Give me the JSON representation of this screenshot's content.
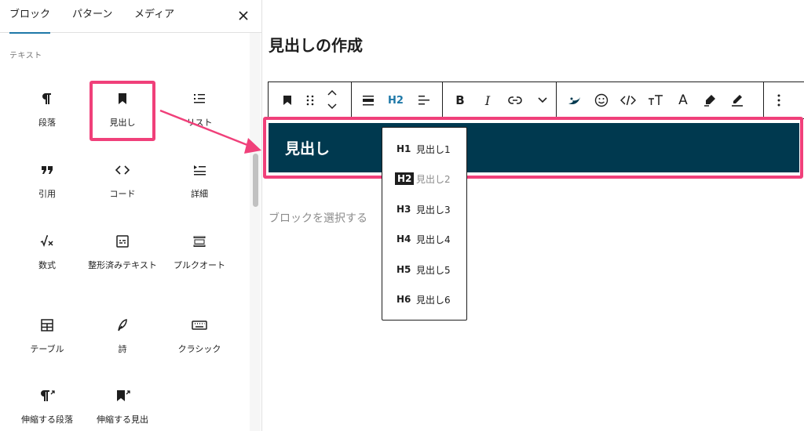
{
  "panel": {
    "tabs": [
      {
        "label": "ブロック",
        "active": true
      },
      {
        "label": "パターン",
        "active": false
      },
      {
        "label": "メディア",
        "active": false
      }
    ],
    "close_icon": "close-icon",
    "category_label": "テキスト",
    "blocks": [
      {
        "label": "段落",
        "icon": "pilcrow-icon"
      },
      {
        "label": "見出し",
        "icon": "bookmark-icon"
      },
      {
        "label": "リスト",
        "icon": "list-icon"
      },
      {
        "label": "引用",
        "icon": "quote-icon"
      },
      {
        "label": "コード",
        "icon": "code-icon"
      },
      {
        "label": "詳細",
        "icon": "details-icon"
      },
      {
        "label": "数式",
        "icon": "math-icon"
      },
      {
        "label": "整形済みテキスト",
        "icon": "preformatted-icon"
      },
      {
        "label": "プルクオート",
        "icon": "pullquote-icon"
      },
      {
        "label": "テーブル",
        "icon": "table-icon"
      },
      {
        "label": "詩",
        "icon": "feather-icon"
      },
      {
        "label": "クラシック",
        "icon": "keyboard-icon"
      },
      {
        "label": "伸縮する段落",
        "icon": "fit-pilcrow-icon"
      },
      {
        "label": "伸縮する見出",
        "icon": "fit-bookmark-icon"
      }
    ]
  },
  "editor": {
    "post_title": "見出しの作成",
    "toolbar": {
      "heading_level_label": "H2",
      "bold_label": "B",
      "italic_label": "I",
      "type_label": "A"
    },
    "heading_text": "見出し",
    "placeholder": "ブロックを選択する",
    "heading_block_color": "#00394f"
  },
  "level_menu": {
    "items": [
      {
        "tag": "H1",
        "name": "見出し1",
        "selected": false
      },
      {
        "tag": "H2",
        "name": "見出し2",
        "selected": true
      },
      {
        "tag": "H3",
        "name": "見出し3",
        "selected": false
      },
      {
        "tag": "H4",
        "name": "見出し4",
        "selected": false
      },
      {
        "tag": "H5",
        "name": "見出し5",
        "selected": false
      },
      {
        "tag": "H6",
        "name": "見出し6",
        "selected": false
      }
    ]
  },
  "colors": {
    "accent": "#1e78a8",
    "highlight": "#f0407a",
    "heading_bg": "#00394f"
  }
}
